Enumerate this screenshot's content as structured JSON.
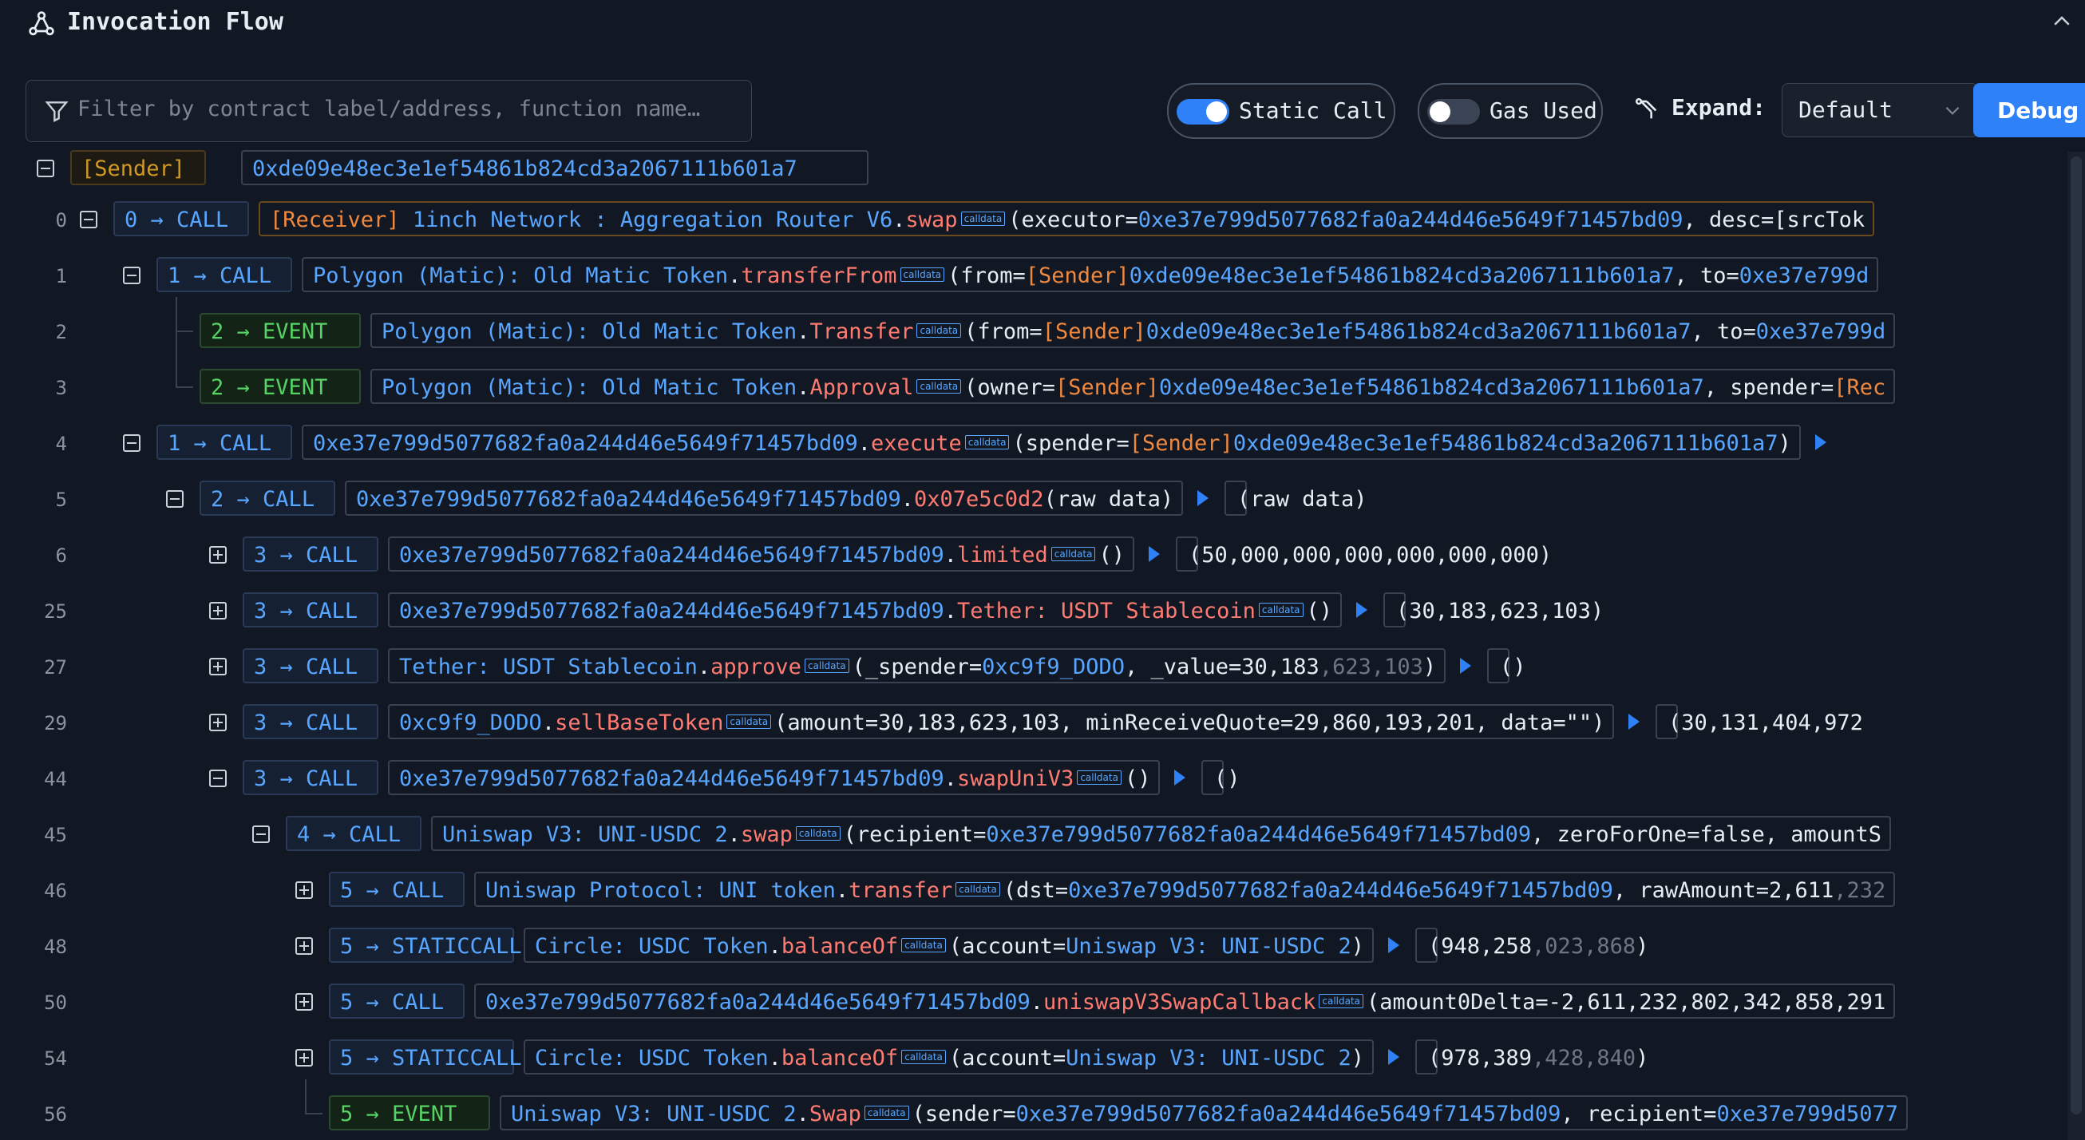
{
  "header": {
    "title": "Invocation Flow"
  },
  "filter": {
    "placeholder": "Filter by contract label/address, function name…"
  },
  "toggles": {
    "static_call": {
      "label": "Static Call",
      "on": true
    },
    "gas_used": {
      "label": "Gas Used",
      "on": false
    }
  },
  "expand": {
    "label": "Expand:",
    "value": "Default"
  },
  "debug_label": "Debug",
  "sender": {
    "tag": "[Sender]",
    "address": "0xde09e48ec3e1ef54861b824cd3a2067111b601a7"
  },
  "calldata_label": "calldata",
  "rows": [
    {
      "line": "0",
      "depth": "0",
      "type": "CALL",
      "prefix": "[Receiver] ",
      "contract": "1inch Network : Aggregation Router V6",
      "method": "swap",
      "args_pre": "(executor=",
      "args_addr": "0xe37e799d5077682fa0a244d46e5649f71457bd09",
      "args_post": ", desc=[srcTok"
    },
    {
      "line": "1",
      "depth": "1",
      "type": "CALL",
      "contract": "Polygon (Matic): Old Matic Token",
      "method": "transferFrom",
      "args_pre": "(from=",
      "args_tag": "[Sender]",
      "args_addr": "0xde09e48ec3e1ef54861b824cd3a2067111b601a7",
      "args_post": ", to=",
      "args_tail": "0xe37e799d"
    },
    {
      "line": "2",
      "depth": "2",
      "type": "EVENT",
      "contract": "Polygon (Matic): Old Matic Token",
      "method": "Transfer",
      "args_pre": "(from=",
      "args_tag": "[Sender]",
      "args_addr": "0xde09e48ec3e1ef54861b824cd3a2067111b601a7",
      "args_post": ", to=",
      "args_tail": "0xe37e799d"
    },
    {
      "line": "3",
      "depth": "2",
      "type": "EVENT",
      "contract": "Polygon (Matic): Old Matic Token",
      "method": "Approval",
      "args_pre": "(owner=",
      "args_tag": "[Sender]",
      "args_addr": "0xde09e48ec3e1ef54861b824cd3a2067111b601a7",
      "args_post": ", spender=",
      "args_tail2": "[Rec"
    },
    {
      "line": "4",
      "depth": "1",
      "type": "CALL",
      "contract": "0xe37e799d5077682fa0a244d46e5649f71457bd09",
      "method": "execute",
      "args_pre": "(spender=",
      "args_tag": "[Sender]",
      "args_addr": "0xde09e48ec3e1ef54861b824cd3a2067111b601a7",
      "args_post": ")"
    },
    {
      "line": "5",
      "depth": "2",
      "type": "CALL",
      "contract": "0xe37e799d5077682fa0a244d46e5649f71457bd09",
      "method": "0x07e5c0d2",
      "args_pre": "(raw data)",
      "result": "(raw data)"
    },
    {
      "line": "6",
      "depth": "3",
      "type": "CALL",
      "contract": "0xe37e799d5077682fa0a244d46e5649f71457bd09",
      "method": "limited",
      "args_pre": "()",
      "result": "(50,000,000,000,000,000,000)"
    },
    {
      "line": "25",
      "depth": "3",
      "type": "CALL",
      "contract": "0xe37e799d5077682fa0a244d46e5649f71457bd09",
      "method": "Tether: USDT Stablecoin",
      "args_pre": "()",
      "result": "(30,183,623,103)"
    },
    {
      "line": "27",
      "depth": "3",
      "type": "CALL",
      "contract": "Tether: USDT Stablecoin",
      "method": "approve",
      "args_pre": "(_spender=",
      "args_addr": "0xc9f9_DODO",
      "args_post": ", _value=30,183",
      "args_grey": ",623,103",
      "args_end": ")",
      "result": "()"
    },
    {
      "line": "29",
      "depth": "3",
      "type": "CALL",
      "contract": "0xc9f9_DODO",
      "method": "sellBaseToken",
      "args_pre": "(amount=30,183,623,103, minReceiveQuote=29,860,193,201, data=\"\")",
      "result": "(30,131,404,972"
    },
    {
      "line": "44",
      "depth": "3",
      "type": "CALL",
      "contract": "0xe37e799d5077682fa0a244d46e5649f71457bd09",
      "method": "swapUniV3",
      "args_pre": "()",
      "result": "()"
    },
    {
      "line": "45",
      "depth": "4",
      "type": "CALL",
      "contract": "Uniswap V3: UNI-USDC 2",
      "method": "swap",
      "args_pre": "(recipient=",
      "args_addr": "0xe37e799d5077682fa0a244d46e5649f71457bd09",
      "args_post": ", zeroForOne=false, amountS"
    },
    {
      "line": "46",
      "depth": "5",
      "type": "CALL",
      "contract": "Uniswap Protocol: UNI token",
      "method": "transfer",
      "args_pre": "(dst=",
      "args_addr": "0xe37e799d5077682fa0a244d46e5649f71457bd09",
      "args_post": ", rawAmount=2,611",
      "args_grey": ",232"
    },
    {
      "line": "48",
      "depth": "5",
      "type": "STATICCALL",
      "contract": "Circle: USDC Token",
      "method": "balanceOf",
      "args_pre": "(account=",
      "args_addr": "Uniswap V3: UNI-USDC 2",
      "args_post": ")",
      "result": "(948,258",
      "result_grey": ",023,868",
      "result_end": ")"
    },
    {
      "line": "50",
      "depth": "5",
      "type": "CALL",
      "contract": "0xe37e799d5077682fa0a244d46e5649f71457bd09",
      "method": "uniswapV3SwapCallback",
      "args_pre": "(amount0Delta=-2,611,232,802,342,858,291"
    },
    {
      "line": "54",
      "depth": "5",
      "type": "STATICCALL",
      "contract": "Circle: USDC Token",
      "method": "balanceOf",
      "args_pre": "(account=",
      "args_addr": "Uniswap V3: UNI-USDC 2",
      "args_post": ")",
      "result": "(978,389",
      "result_grey": ",428,840",
      "result_end": ")"
    },
    {
      "line": "56",
      "depth": "5",
      "type": "EVENT",
      "contract": "Uniswap V3: UNI-USDC 2",
      "method": "Swap",
      "args_pre": "(sender=",
      "args_addr": "0xe37e799d5077682fa0a244d46e5649f71457bd09",
      "args_post": ", recipient=",
      "args_tail": "0xe37e799d5077"
    }
  ]
}
